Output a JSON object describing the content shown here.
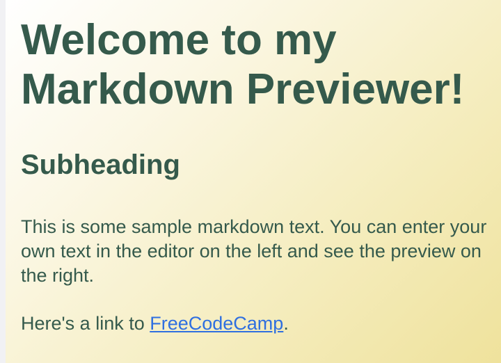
{
  "preview": {
    "heading": "Welcome to my Markdown Previewer!",
    "subheading": "Subheading",
    "paragraph": "This is some sample markdown text. You can enter your own text in the editor on the left and see the preview on the right.",
    "link_line": {
      "prefix": "Here's a link to ",
      "link_text": "FreeCodeCamp",
      "suffix": "."
    }
  },
  "colors": {
    "text": "#355a4c",
    "link": "#2f6fe0",
    "gradient_start": "#ffffff",
    "gradient_end": "#efe29c"
  }
}
